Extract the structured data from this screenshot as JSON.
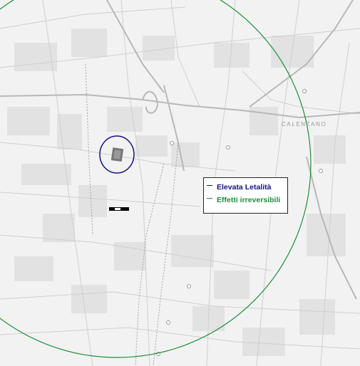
{
  "map": {
    "town_label": "CALENZANO",
    "legend": [
      {
        "label": "Elevata Letalità",
        "color": "#12128a"
      },
      {
        "label": "Effetti irreversibili",
        "color": "#1d8f3a"
      }
    ],
    "colors": {
      "background": "#f2f2f2",
      "roads": "#c9c9c9",
      "major_roads": "#bdbdbd",
      "blocks": "#e0e0e0",
      "railway": "#9a9a9a"
    }
  }
}
